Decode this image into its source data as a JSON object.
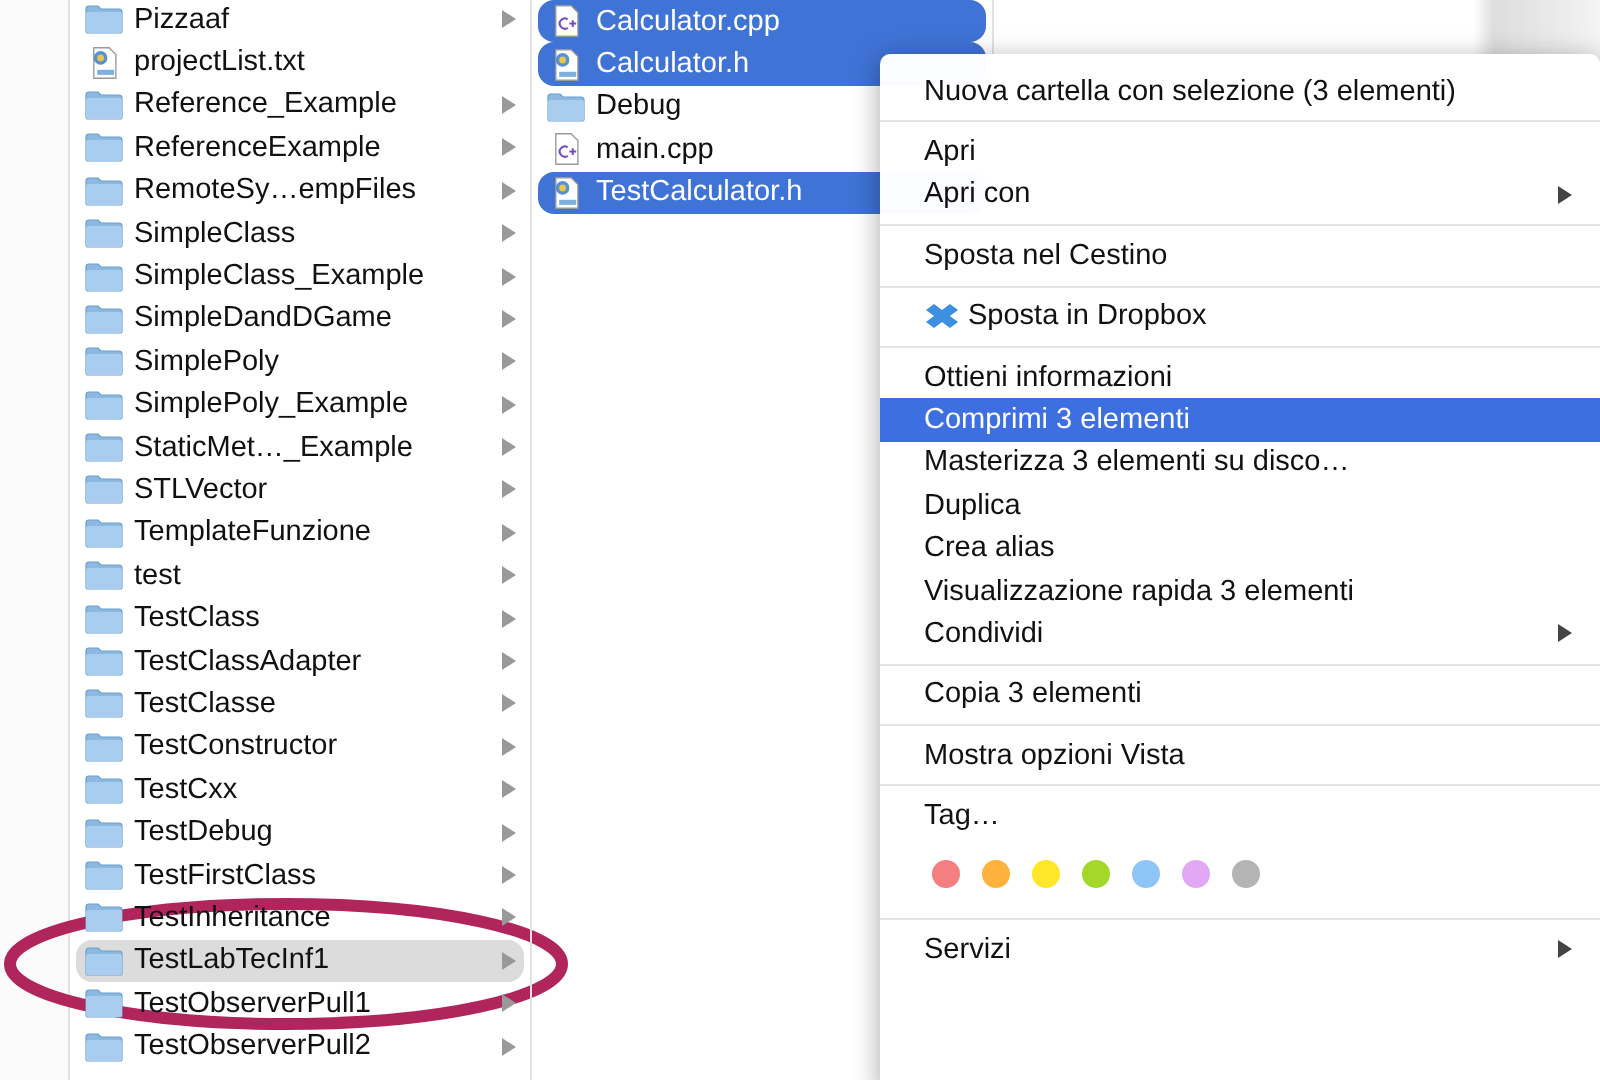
{
  "columns": [
    {
      "items": [
        {
          "name": "Pizzaaf",
          "kind": "folder",
          "selected": false,
          "highlighted": false
        },
        {
          "name": "projectList.txt",
          "kind": "text",
          "selected": false,
          "highlighted": false
        },
        {
          "name": "Reference_Example",
          "kind": "folder",
          "selected": false,
          "highlighted": false
        },
        {
          "name": "ReferenceExample",
          "kind": "folder",
          "selected": false,
          "highlighted": false
        },
        {
          "name": "RemoteSy…empFiles",
          "kind": "folder",
          "selected": false,
          "highlighted": false
        },
        {
          "name": "SimpleClass",
          "kind": "folder",
          "selected": false,
          "highlighted": false
        },
        {
          "name": "SimpleClass_Example",
          "kind": "folder",
          "selected": false,
          "highlighted": false
        },
        {
          "name": "SimpleDandDGame",
          "kind": "folder",
          "selected": false,
          "highlighted": false
        },
        {
          "name": "SimplePoly",
          "kind": "folder",
          "selected": false,
          "highlighted": false
        },
        {
          "name": "SimplePoly_Example",
          "kind": "folder",
          "selected": false,
          "highlighted": false
        },
        {
          "name": "StaticMet…_Example",
          "kind": "folder",
          "selected": false,
          "highlighted": false
        },
        {
          "name": "STLVector",
          "kind": "folder",
          "selected": false,
          "highlighted": false
        },
        {
          "name": "TemplateFunzione",
          "kind": "folder",
          "selected": false,
          "highlighted": false
        },
        {
          "name": "test",
          "kind": "folder",
          "selected": false,
          "highlighted": false
        },
        {
          "name": "TestClass",
          "kind": "folder",
          "selected": false,
          "highlighted": false
        },
        {
          "name": "TestClassAdapter",
          "kind": "folder",
          "selected": false,
          "highlighted": false
        },
        {
          "name": "TestClasse",
          "kind": "folder",
          "selected": false,
          "highlighted": false
        },
        {
          "name": "TestConstructor",
          "kind": "folder",
          "selected": false,
          "highlighted": false
        },
        {
          "name": "TestCxx",
          "kind": "folder",
          "selected": false,
          "highlighted": false
        },
        {
          "name": "TestDebug",
          "kind": "folder",
          "selected": false,
          "highlighted": false
        },
        {
          "name": "TestFirstClass",
          "kind": "folder",
          "selected": false,
          "highlighted": false
        },
        {
          "name": "TestInheritance",
          "kind": "folder",
          "selected": false,
          "highlighted": false
        },
        {
          "name": "TestLabTecInf1",
          "kind": "folder",
          "selected": false,
          "highlighted": true
        },
        {
          "name": "TestObserverPull1",
          "kind": "folder",
          "selected": false,
          "highlighted": false
        },
        {
          "name": "TestObserverPull2",
          "kind": "folder",
          "selected": false,
          "highlighted": false
        }
      ]
    },
    {
      "items": [
        {
          "name": "Calculator.cpp",
          "kind": "cpp",
          "selected": true
        },
        {
          "name": "Calculator.h",
          "kind": "header",
          "selected": true
        },
        {
          "name": "Debug",
          "kind": "folder",
          "selected": false
        },
        {
          "name": "main.cpp",
          "kind": "cpp",
          "selected": false
        },
        {
          "name": "TestCalculator.h",
          "kind": "header",
          "selected": true
        }
      ]
    }
  ],
  "context_menu": {
    "groups": [
      {
        "items": [
          {
            "label": "Nuova cartella con selezione (3 elementi)",
            "kind": "text",
            "highlighted": false,
            "submenu": false
          }
        ]
      },
      {
        "items": [
          {
            "label": "Apri",
            "kind": "text",
            "highlighted": false,
            "submenu": false
          },
          {
            "label": "Apri con",
            "kind": "text",
            "highlighted": false,
            "submenu": true
          }
        ]
      },
      {
        "items": [
          {
            "label": "Sposta nel Cestino",
            "kind": "text",
            "highlighted": false,
            "submenu": false
          }
        ]
      },
      {
        "items": [
          {
            "label": "Sposta in Dropbox",
            "kind": "dropbox",
            "highlighted": false,
            "submenu": false
          }
        ]
      },
      {
        "items": [
          {
            "label": "Ottieni informazioni",
            "kind": "text",
            "highlighted": false,
            "submenu": false
          },
          {
            "label": "Comprimi 3 elementi",
            "kind": "text",
            "highlighted": true,
            "submenu": false
          },
          {
            "label": "Masterizza 3 elementi su disco…",
            "kind": "text",
            "highlighted": false,
            "submenu": false
          },
          {
            "label": "Duplica",
            "kind": "text",
            "highlighted": false,
            "submenu": false
          },
          {
            "label": "Crea alias",
            "kind": "text",
            "highlighted": false,
            "submenu": false
          },
          {
            "label": "Visualizzazione rapida 3 elementi",
            "kind": "text",
            "highlighted": false,
            "submenu": false
          },
          {
            "label": "Condividi",
            "kind": "text",
            "highlighted": false,
            "submenu": true
          }
        ]
      },
      {
        "items": [
          {
            "label": "Copia 3 elementi",
            "kind": "text",
            "highlighted": false,
            "submenu": false
          }
        ]
      },
      {
        "items": [
          {
            "label": "Mostra opzioni Vista",
            "kind": "text",
            "highlighted": false,
            "submenu": false
          }
        ]
      },
      {
        "items": [
          {
            "label": "Tag…",
            "kind": "text",
            "highlighted": false,
            "submenu": false
          },
          {
            "kind": "tags",
            "tags": [
              {
                "color": "#f47f80"
              },
              {
                "color": "#ffb33c"
              },
              {
                "color": "#ffe629"
              },
              {
                "color": "#a3d82a"
              },
              {
                "color": "#8ec5f7"
              },
              {
                "color": "#e3a8f5"
              },
              {
                "color": "#b4b4b4"
              }
            ]
          }
        ]
      },
      {
        "items": [
          {
            "label": "Servizi",
            "kind": "text",
            "highlighted": false,
            "submenu": true
          }
        ]
      }
    ]
  }
}
